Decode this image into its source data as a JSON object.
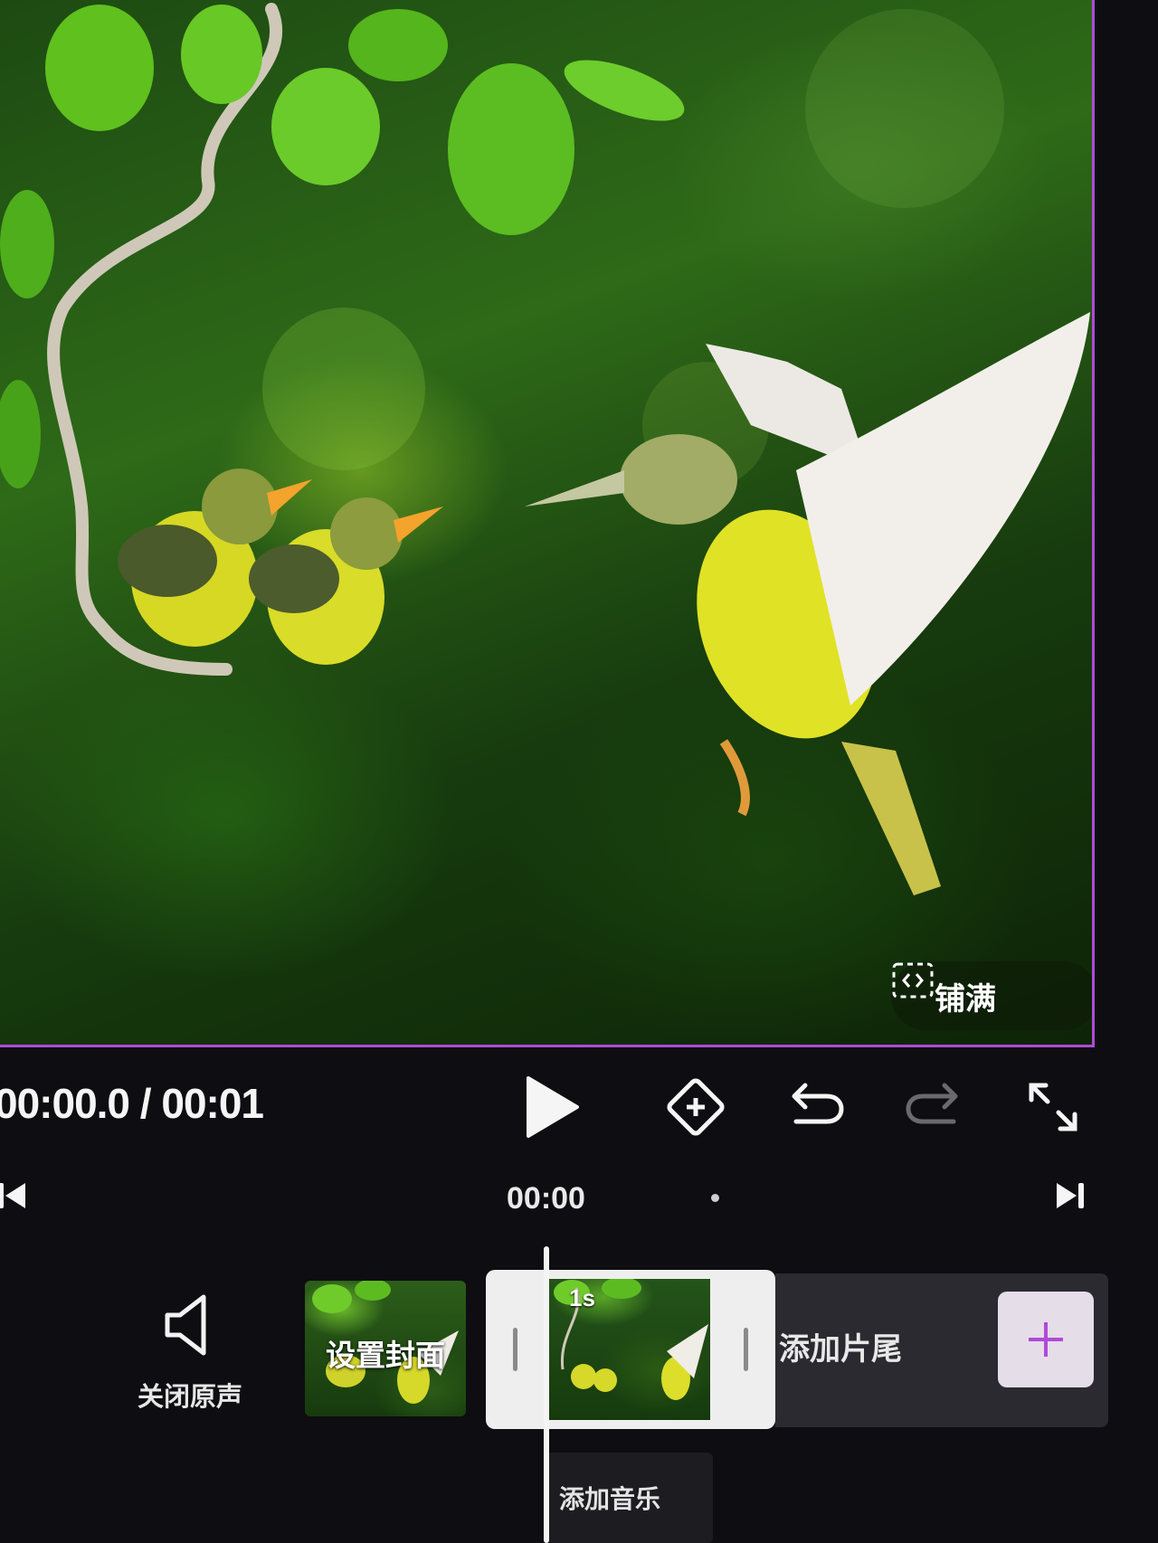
{
  "preview": {
    "fill_label": "铺满",
    "fill_icon": "fit-fill-icon",
    "accent": "#b04ad8"
  },
  "playback": {
    "timecode": "00:00.0 / 00:01",
    "icons": [
      "play-icon",
      "add-keyframe-icon",
      "undo-icon",
      "redo-icon",
      "fullscreen-icon"
    ]
  },
  "ruler": {
    "current_time": "00:00",
    "icons": [
      "skip-to-start-icon",
      "skip-to-end-icon"
    ]
  },
  "timeline": {
    "mute_label": "关闭原声",
    "cover_label": "设置封面",
    "clip_duration": "1s",
    "ending_label": "添加片尾",
    "music_label": "添加音乐",
    "icons": [
      "speaker-icon",
      "plus-icon"
    ]
  }
}
